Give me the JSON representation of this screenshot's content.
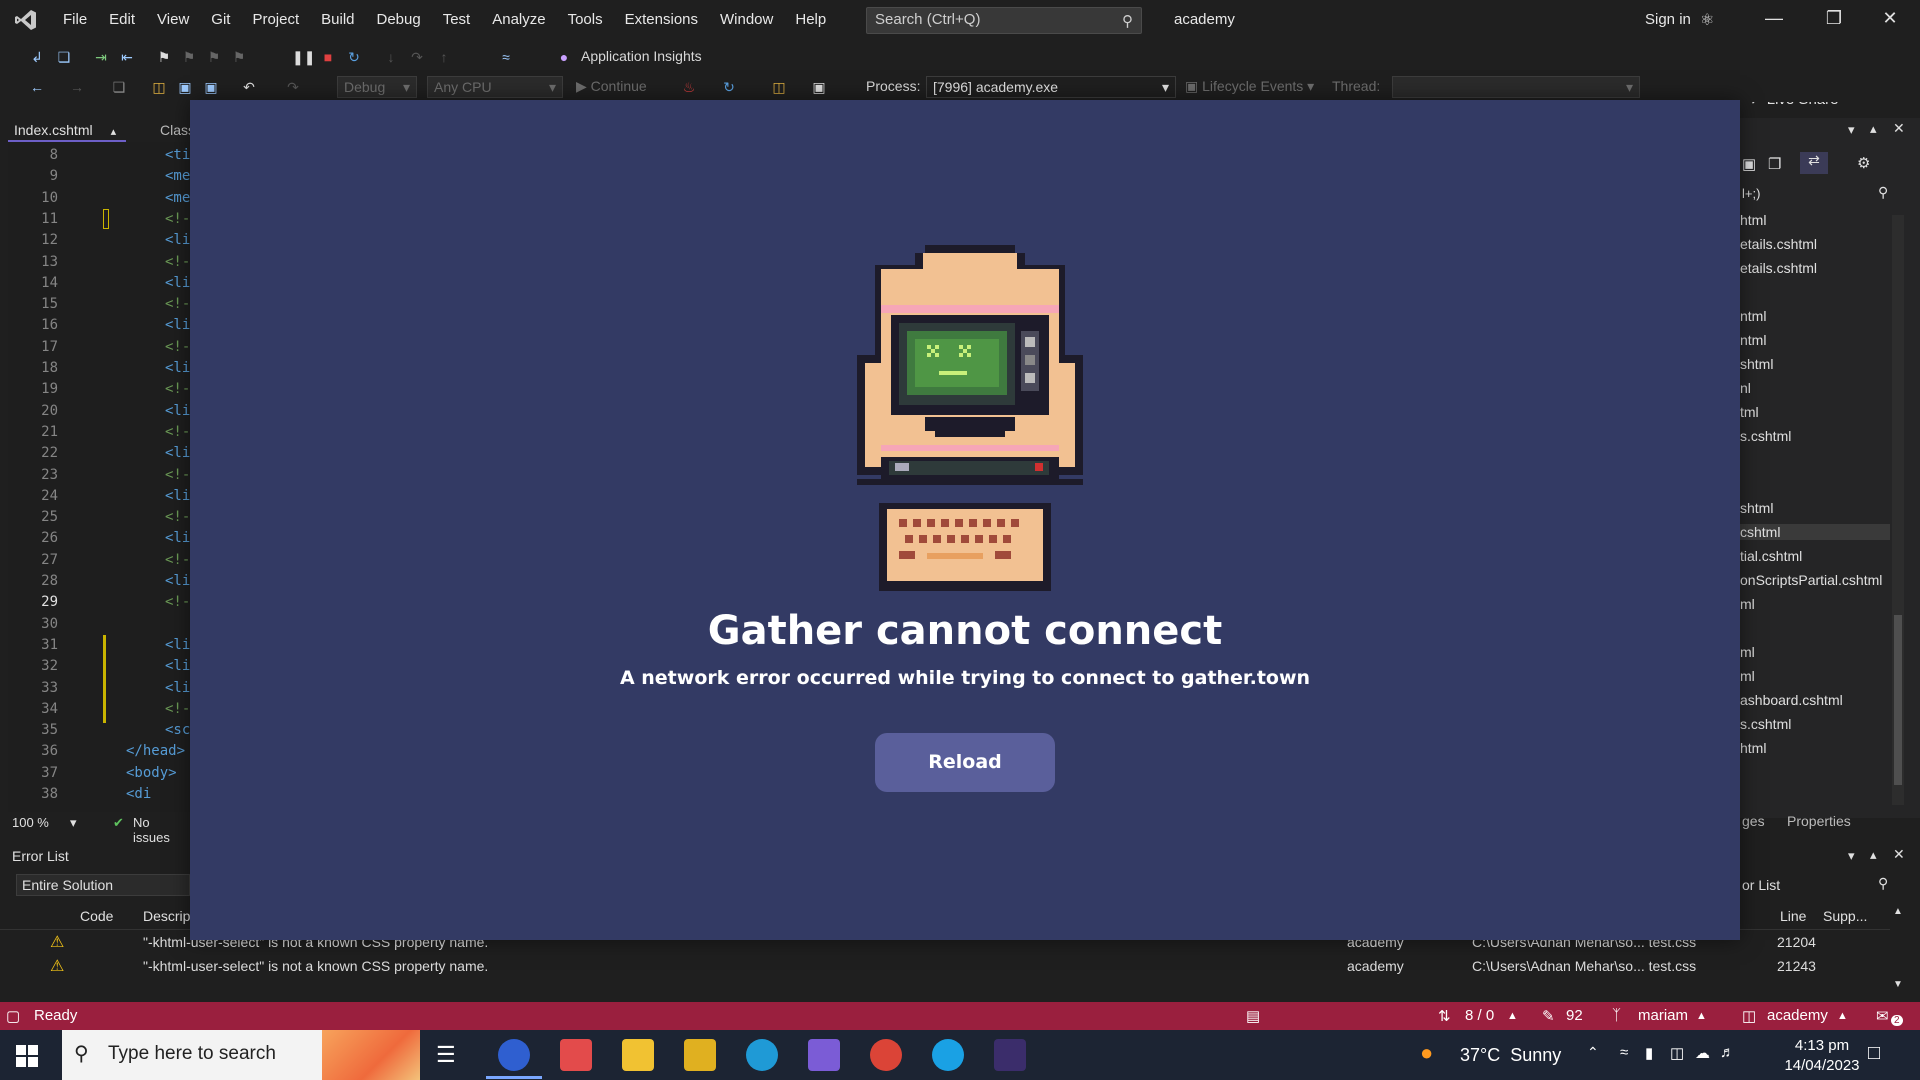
{
  "menubar": {
    "items": [
      "File",
      "Edit",
      "View",
      "Git",
      "Project",
      "Build",
      "Debug",
      "Test",
      "Analyze",
      "Tools",
      "Extensions",
      "Window",
      "Help"
    ],
    "search_placeholder": "Search (Ctrl+Q)",
    "solution_name": "academy",
    "sign_in": "Sign in",
    "live_share": "Live Share"
  },
  "toolbar": {
    "app_insights": "Application Insights",
    "config": "Debug",
    "platform": "Any CPU",
    "continue": "Continue",
    "process_label": "Process:",
    "process_value": "[7996] academy.exe",
    "lifecycle": "Lifecycle Events",
    "thread_label": "Thread:"
  },
  "editor": {
    "tabs": [
      "Index.cshtml",
      "Class"
    ],
    "line_numbers": [
      "8",
      "9",
      "10",
      "11",
      "12",
      "13",
      "14",
      "15",
      "16",
      "17",
      "18",
      "19",
      "20",
      "21",
      "22",
      "23",
      "24",
      "25",
      "26",
      "27",
      "28",
      "29",
      "30",
      "31",
      "32",
      "33",
      "34",
      "35",
      "36",
      "37",
      "38"
    ],
    "code_lines": [
      "<ti",
      "<me",
      "<me",
      "<!-",
      "<li",
      "<!-",
      "<li",
      "<!-",
      "<li",
      "<!-",
      "<li",
      "<!-",
      "<li",
      "<!-",
      "<li",
      "<!-",
      "<li",
      "<!-",
      "<li",
      "<!-",
      "<li",
      "<!-",
      "",
      "<li",
      "<li",
      "<li",
      "<!-",
      "<sc",
      "</head>",
      "<body>",
      "<di"
    ],
    "zoom": "100 %",
    "issues": "No issues"
  },
  "solution_explorer": {
    "search_fragment": "l+;)",
    "items": [
      "html",
      "etails.cshtml",
      "etails.cshtml",
      "ntml",
      "ntml",
      "shtml",
      "nl",
      "tml",
      "s.cshtml",
      "shtml",
      "cshtml",
      "tial.cshtml",
      "onScriptsPartial.cshtml",
      "ml",
      "ml",
      "ml",
      "ashboard.cshtml",
      "s.cshtml",
      "html"
    ],
    "bottom_tabs": [
      "ges",
      "Properties"
    ]
  },
  "error_list": {
    "title": "Error List",
    "scope": "Entire Solution",
    "search_fragment": "or List",
    "columns": [
      "Code",
      "Descrip",
      "Line",
      "Supp..."
    ],
    "rows": [
      {
        "desc": "\"-khtml-user-select\" is not a known CSS property name.",
        "project": "academy",
        "file": "C:\\Users\\Adnan Mehar\\so... test.css",
        "line": "21204"
      },
      {
        "desc": "\"-khtml-user-select\" is not a known CSS property name.",
        "project": "academy",
        "file": "C:\\Users\\Adnan Mehar\\so... test.css",
        "line": "21243"
      }
    ]
  },
  "statusbar": {
    "ready": "Ready",
    "lines": "8 / 0",
    "edits": "92",
    "branch": "mariam",
    "repo": "academy",
    "notifications": "2"
  },
  "taskbar": {
    "search_placeholder": "Type here to search",
    "weather": "37°C  Sunny",
    "time": "4:13 pm",
    "date": "14/04/2023"
  },
  "modal": {
    "title": "Gather cannot connect",
    "message": "A network error occurred while trying to connect to gather.town",
    "button": "Reload"
  }
}
